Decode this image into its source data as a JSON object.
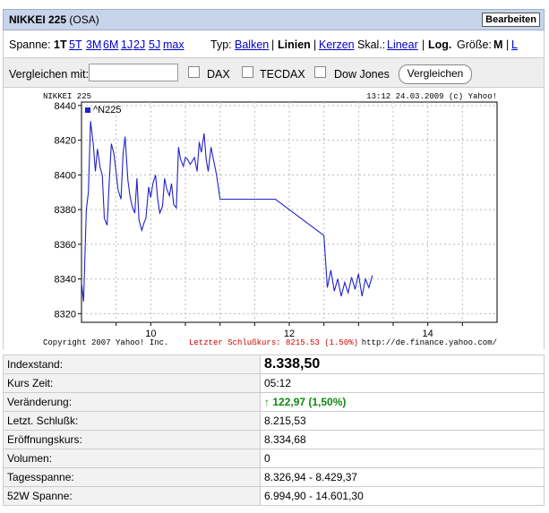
{
  "header": {
    "title_bold": "NIKKEI 225",
    "title_rest": " (OSA)",
    "edit_button": "Bearbeiten"
  },
  "toolbar": {
    "spanne_label": "Spanne:",
    "spanne_active": "1T",
    "spanne_links": [
      "5T",
      "3M",
      "6M",
      "1J",
      "2J",
      "5J",
      "max"
    ],
    "typ_label": "Typ:",
    "typ_balken": "Balken",
    "typ_sep1": "|",
    "typ_linien": "Linien",
    "typ_sep2": "|",
    "typ_kerzen": "Kerzen",
    "skal_label": "Skal.:",
    "skal_linear": "Linear",
    "skal_sep": "|",
    "skal_log": "Log.",
    "groesse_label": "Größe:",
    "groesse_m": "M",
    "groesse_sep": "|",
    "groesse_l": "L"
  },
  "compare": {
    "label": "Vergleichen mit:",
    "input_value": "",
    "options": [
      "DAX",
      "TECDAX",
      "Dow Jones"
    ],
    "button": "Vergleichen"
  },
  "chart_data": {
    "type": "line",
    "title": "NIKKEI 225",
    "timestamp": "13:12 24.03.2009 (c) Yahoo!",
    "series": [
      {
        "name": "^N225",
        "color": "#2222cc",
        "x": [
          9.0,
          9.03,
          9.07,
          9.1,
          9.13,
          9.17,
          9.2,
          9.23,
          9.27,
          9.3,
          9.33,
          9.37,
          9.4,
          9.43,
          9.47,
          9.5,
          9.53,
          9.57,
          9.6,
          9.63,
          9.67,
          9.7,
          9.73,
          9.77,
          9.8,
          9.83,
          9.87,
          9.9,
          9.93,
          9.97,
          10.0,
          10.03,
          10.07,
          10.1,
          10.13,
          10.17,
          10.2,
          10.23,
          10.27,
          10.3,
          10.33,
          10.37,
          10.4,
          10.43,
          10.47,
          10.5,
          10.53,
          10.57,
          10.6,
          10.63,
          10.67,
          10.7,
          10.73,
          10.77,
          10.8,
          10.83,
          10.87,
          10.9,
          10.95,
          11.0,
          11.5,
          11.8,
          12.5,
          12.55,
          12.6,
          12.65,
          12.7,
          12.75,
          12.8,
          12.85,
          12.9,
          12.95,
          13.0,
          13.05,
          13.1,
          13.15,
          13.2
        ],
        "values": [
          8338,
          8327,
          8380,
          8390,
          8431,
          8418,
          8402,
          8415,
          8404,
          8400,
          8375,
          8371,
          8395,
          8418,
          8412,
          8401,
          8391,
          8386,
          8412,
          8422,
          8397,
          8388,
          8382,
          8378,
          8398,
          8374,
          8368,
          8372,
          8375,
          8393,
          8387,
          8395,
          8400,
          8386,
          8378,
          8382,
          8398,
          8392,
          8388,
          8395,
          8383,
          8381,
          8416,
          8409,
          8405,
          8410,
          8409,
          8406,
          8408,
          8410,
          8402,
          8419,
          8413,
          8424,
          8409,
          8402,
          8416,
          8410,
          8400,
          8386,
          8386,
          8386,
          8365,
          8335,
          8345,
          8333,
          8340,
          8330,
          8338,
          8332,
          8341,
          8334,
          8343,
          8330,
          8340,
          8335,
          8342
        ]
      }
    ],
    "xticks": [
      10,
      12,
      14
    ],
    "yticks": [
      8320,
      8340,
      8360,
      8380,
      8400,
      8420,
      8440
    ],
    "xlim": [
      9.0,
      15.0
    ],
    "ylim": [
      8315,
      8442
    ],
    "grid": true,
    "legend_position": "top-left",
    "copyright": "Copyright 2007 Yahoo! Inc.",
    "last_close_note": "Letzter Schlußkurs: 8215.53 (1.50%)",
    "last_close_color": "#cc0000",
    "source": "http://de.finance.yahoo.com/"
  },
  "stats": [
    {
      "label": "Indexstand:",
      "value": "8.338,50",
      "big": true
    },
    {
      "label": "Kurs Zeit:",
      "value": "05:12"
    },
    {
      "label": "Veränderung:",
      "value": "122,97 (1,50%)",
      "arrow": "↑",
      "color": "#118811"
    },
    {
      "label": "Letzt. Schlußk:",
      "value": "8.215,53"
    },
    {
      "label": "Eröffnungskurs:",
      "value": "8.334,68"
    },
    {
      "label": "Volumen:",
      "value": "0"
    },
    {
      "label": "Tagesspanne:",
      "value": "8.326,94 - 8.429,37"
    },
    {
      "label": "52W Spanne:",
      "value": "6.994,90 - 14.601,30"
    }
  ]
}
